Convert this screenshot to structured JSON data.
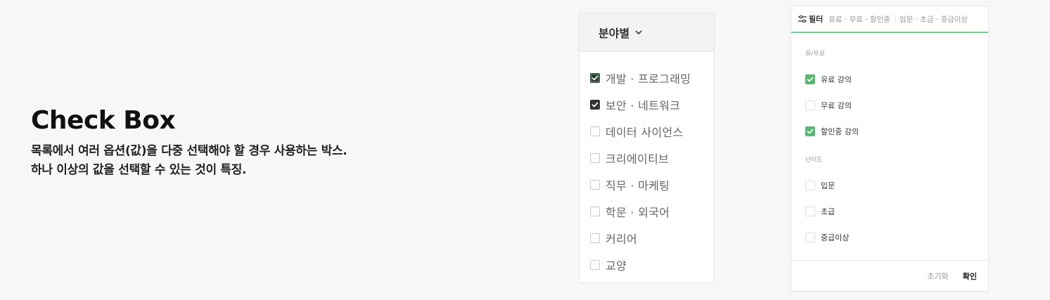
{
  "intro": {
    "title": "Check Box",
    "line1": "목록에서 여러 옵션(값)을 다중 선택해야 할 경우 사용하는 박스.",
    "line2": "하나 이상의 값을 선택할 수 있는 것이 특징."
  },
  "category_panel": {
    "header": "분야별",
    "header_icon": "chevron-down-icon",
    "items": [
      {
        "label": "개발 · 프로그래밍",
        "checked": true
      },
      {
        "label": "보안 · 네트워크",
        "checked": true
      },
      {
        "label": "데이터 사이언스",
        "checked": false
      },
      {
        "label": "크리에이티브",
        "checked": false
      },
      {
        "label": "직무 · 마케팅",
        "checked": false
      },
      {
        "label": "학문 · 외국어",
        "checked": false
      },
      {
        "label": "커리어",
        "checked": false
      },
      {
        "label": "교양",
        "checked": false
      }
    ]
  },
  "filter_panel": {
    "header_icon": "filter-sliders-icon",
    "header_title": "필터",
    "summary_price": "유료 · 무료 · 할인중",
    "summary_level": "입문 · 초급 · 중급이상",
    "groups": [
      {
        "label": "유/무료",
        "items": [
          {
            "label": "유료 강의",
            "checked": true
          },
          {
            "label": "무료 강의",
            "checked": false
          },
          {
            "label": "할인중 강의",
            "checked": true
          }
        ]
      },
      {
        "label": "난이도",
        "items": [
          {
            "label": "입문",
            "checked": false
          },
          {
            "label": "초급",
            "checked": false
          },
          {
            "label": "중급이상",
            "checked": false
          }
        ]
      }
    ],
    "reset_label": "초기화",
    "confirm_label": "확인"
  },
  "colors": {
    "accent_green": "#55b86f",
    "dark_check": "#333333"
  }
}
